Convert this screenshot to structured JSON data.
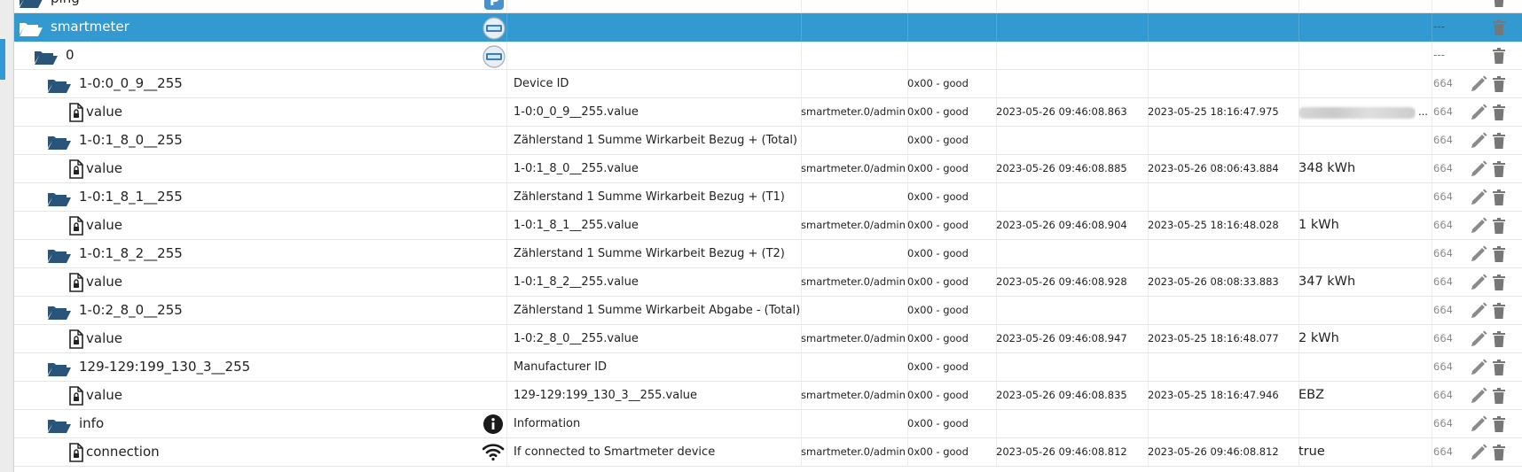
{
  "rows": [
    {
      "name": "ping",
      "kind": "folder",
      "level": 0,
      "partial": true,
      "role_icon": "p-adapter-icon"
    },
    {
      "name": "smartmeter",
      "kind": "folder",
      "level": 0,
      "selected": true,
      "role_icon": "smartmeter-adapter-icon",
      "acl": "---"
    },
    {
      "name": "0",
      "kind": "folder",
      "level": 1,
      "role_icon": "smartmeter-adapter-icon",
      "acl": "---"
    },
    {
      "name": "1-0:0_0_9__255",
      "kind": "folder",
      "level": 2,
      "desc": "Device ID",
      "status": "0x00 - good",
      "acl": "664"
    },
    {
      "name": "value",
      "kind": "state",
      "level": 3,
      "desc": "1-0:0_0_9__255.value",
      "from": "smartmeter.0/admin",
      "status": "0x00 - good",
      "ts": "2023-05-26 09:46:08.863",
      "lc": "2023-05-25 18:16:47.975",
      "value_blurred": true,
      "ellipsis": "...",
      "acl": "664"
    },
    {
      "name": "1-0:1_8_0__255",
      "kind": "folder",
      "level": 2,
      "desc": "Zählerstand 1 Summe Wirkarbeit Bezug + (Total)",
      "status": "0x00 - good",
      "acl": "664"
    },
    {
      "name": "value",
      "kind": "state",
      "level": 3,
      "desc": "1-0:1_8_0__255.value",
      "from": "smartmeter.0/admin",
      "status": "0x00 - good",
      "ts": "2023-05-26 09:46:08.885",
      "lc": "2023-05-26 08:06:43.884",
      "value": "348 kWh",
      "acl": "664"
    },
    {
      "name": "1-0:1_8_1__255",
      "kind": "folder",
      "level": 2,
      "desc": "Zählerstand 1 Summe Wirkarbeit Bezug + (T1)",
      "status": "0x00 - good",
      "acl": "664"
    },
    {
      "name": "value",
      "kind": "state",
      "level": 3,
      "desc": "1-0:1_8_1__255.value",
      "from": "smartmeter.0/admin",
      "status": "0x00 - good",
      "ts": "2023-05-26 09:46:08.904",
      "lc": "2023-05-25 18:16:48.028",
      "value": "1 kWh",
      "acl": "664"
    },
    {
      "name": "1-0:1_8_2__255",
      "kind": "folder",
      "level": 2,
      "desc": "Zählerstand 1 Summe Wirkarbeit Bezug + (T2)",
      "status": "0x00 - good",
      "acl": "664"
    },
    {
      "name": "value",
      "kind": "state",
      "level": 3,
      "desc": "1-0:1_8_2__255.value",
      "from": "smartmeter.0/admin",
      "status": "0x00 - good",
      "ts": "2023-05-26 09:46:08.928",
      "lc": "2023-05-26 08:08:33.883",
      "value": "347 kWh",
      "acl": "664"
    },
    {
      "name": "1-0:2_8_0__255",
      "kind": "folder",
      "level": 2,
      "desc": "Zählerstand 1 Summe Wirkarbeit Abgabe - (Total)",
      "status": "0x00 - good",
      "acl": "664"
    },
    {
      "name": "value",
      "kind": "state",
      "level": 3,
      "desc": "1-0:2_8_0__255.value",
      "from": "smartmeter.0/admin",
      "status": "0x00 - good",
      "ts": "2023-05-26 09:46:08.947",
      "lc": "2023-05-25 18:16:48.077",
      "value": "2 kWh",
      "acl": "664"
    },
    {
      "name": "129-129:199_130_3__255",
      "kind": "folder",
      "level": 2,
      "desc": "Manufacturer ID",
      "status": "0x00 - good",
      "acl": "664"
    },
    {
      "name": "value",
      "kind": "state",
      "level": 3,
      "desc": "129-129:199_130_3__255.value",
      "from": "smartmeter.0/admin",
      "status": "0x00 - good",
      "ts": "2023-05-26 09:46:08.835",
      "lc": "2023-05-25 18:16:47.946",
      "value": "EBZ",
      "acl": "664"
    },
    {
      "name": "info",
      "kind": "folder",
      "level": 2,
      "role_icon": "info-icon",
      "desc": "Information",
      "status": "0x00 - good",
      "acl": "664"
    },
    {
      "name": "connection",
      "kind": "state",
      "level": 3,
      "role_icon": "wifi-icon",
      "desc": "If connected to Smartmeter device",
      "from": "smartmeter.0/admin",
      "status": "0x00 - good",
      "ts": "2023-05-26 09:46:08.812",
      "lc": "2023-05-26 09:46:08.812",
      "value": "true",
      "acl": "664"
    }
  ]
}
